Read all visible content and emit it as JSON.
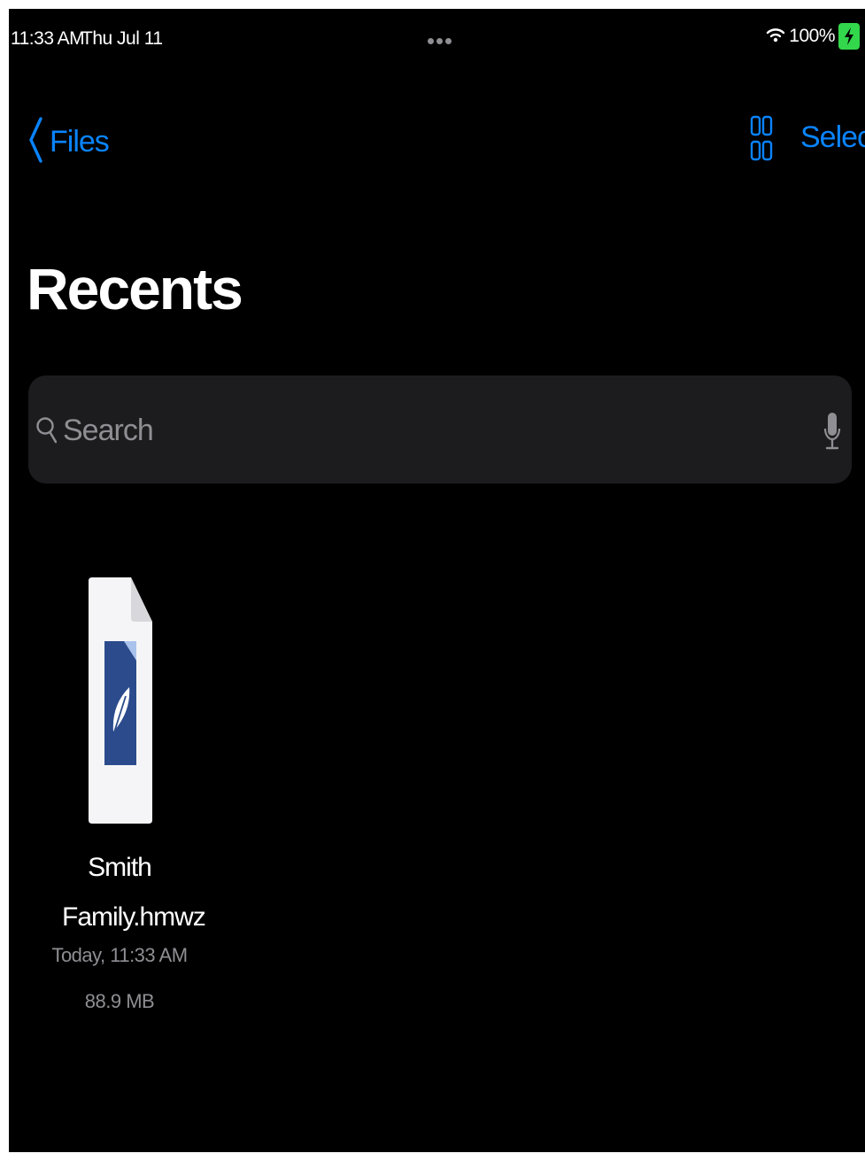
{
  "status_bar": {
    "time": "11:33 AM",
    "date": "Thu Jul 11",
    "battery_percent": "100%",
    "battery_color": "#32d74b",
    "icons": [
      "wifi-icon",
      "battery-charging-icon",
      "multitasking-dots-icon"
    ]
  },
  "nav": {
    "back_label": "Files",
    "back_icon": "chevron-left-icon",
    "view_toggle_icon": "grid-view-icon",
    "select_label": "Select",
    "accent_color": "#0a84ff"
  },
  "page": {
    "title": "Recents"
  },
  "search": {
    "placeholder": "Search",
    "value": "",
    "icons": [
      "search-icon",
      "microphone-icon"
    ]
  },
  "files": [
    {
      "name": "Smith Family.hmwz",
      "name_line1": "Smith",
      "name_line2": "Family.hmwz",
      "modified": "Today, 11:33 AM",
      "size": "88.9 MB",
      "icon": "document-feather-icon"
    }
  ]
}
